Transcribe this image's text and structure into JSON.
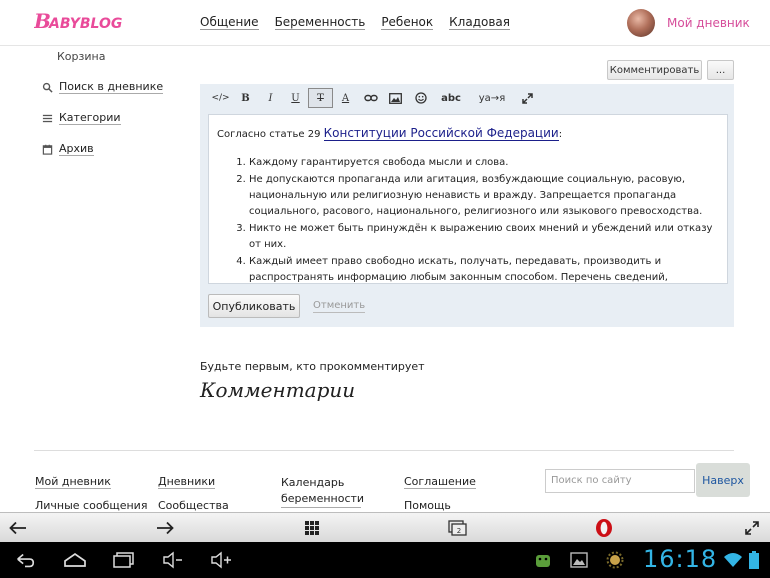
{
  "header": {
    "nav": [
      "Общение",
      "Беременность",
      "Ребенок",
      "Кладовая"
    ],
    "my_diary": "Мой дневник"
  },
  "sidebar": {
    "trash": "Корзина",
    "items": [
      {
        "label": "Поиск в дневнике",
        "icon": "search-icon"
      },
      {
        "label": "Категории",
        "icon": "list-icon"
      },
      {
        "label": "Архив",
        "icon": "calendar-icon"
      }
    ]
  },
  "comment_buttons": {
    "comment": "Комментировать",
    "more": "..."
  },
  "toolbar": {
    "items": [
      {
        "label": "</>",
        "icon": "source-code-icon"
      },
      {
        "label": "B",
        "icon": "bold-icon"
      },
      {
        "label": "I",
        "icon": "italic-icon"
      },
      {
        "label": "U",
        "icon": "underline-icon"
      },
      {
        "label": "T",
        "icon": "strikethrough-icon"
      },
      {
        "label": "A",
        "icon": "text-color-icon"
      },
      {
        "label": "",
        "icon": "link-icon"
      },
      {
        "label": "",
        "icon": "image-icon"
      },
      {
        "label": "",
        "icon": "smiley-icon"
      },
      {
        "label": "abc",
        "icon": "spellcheck-icon"
      },
      {
        "label": "уа→я",
        "icon": "translit-icon"
      },
      {
        "label": "",
        "icon": "fullscreen-icon"
      }
    ]
  },
  "editor": {
    "intro_prefix": "Согласно статье 29",
    "intro_link": "Конституции Российской Федерации",
    "intro_suffix": ":",
    "items": [
      "Каждому гарантируется свобода мысли и слова.",
      "Не допускаются пропаганда или агитация, возбуждающие социальную, расовую, национальную или религиозную ненависть и вражду. Запрещается пропаганда социального, расового, национального, религиозного или языкового превосходства.",
      "Никто не может быть принуждён к выражению своих мнений и убеждений или отказу от них.",
      "Каждый имеет право свободно искать, получать, передавать, производить и распространять информацию любым законным способом. Перечень сведений, составляющих государственную тайну, определяется федеральным законом."
    ],
    "publish": "Опубликовать",
    "cancel": "Отменить"
  },
  "comments": {
    "first": "Будьте первым, кто прокомментирует",
    "title": "Комментарии"
  },
  "footer": {
    "col1": [
      "Мой дневник",
      "Личные сообщения"
    ],
    "col2": [
      "Дневники",
      "Сообщества"
    ],
    "col3": [
      "Календарь беременности"
    ],
    "col4": [
      "Соглашение",
      "Помощь"
    ],
    "search_placeholder": "Поиск по сайту",
    "search_button": "Наверх"
  },
  "browser_bar": [
    "back-arrow-icon",
    "forward-arrow-icon",
    "grid-icon",
    "tabs-icon",
    "opera-icon",
    "fullscreen-icon"
  ],
  "browser_tabs_count": "2",
  "system": {
    "clock": "16:18",
    "accent": "#33b5e5"
  }
}
